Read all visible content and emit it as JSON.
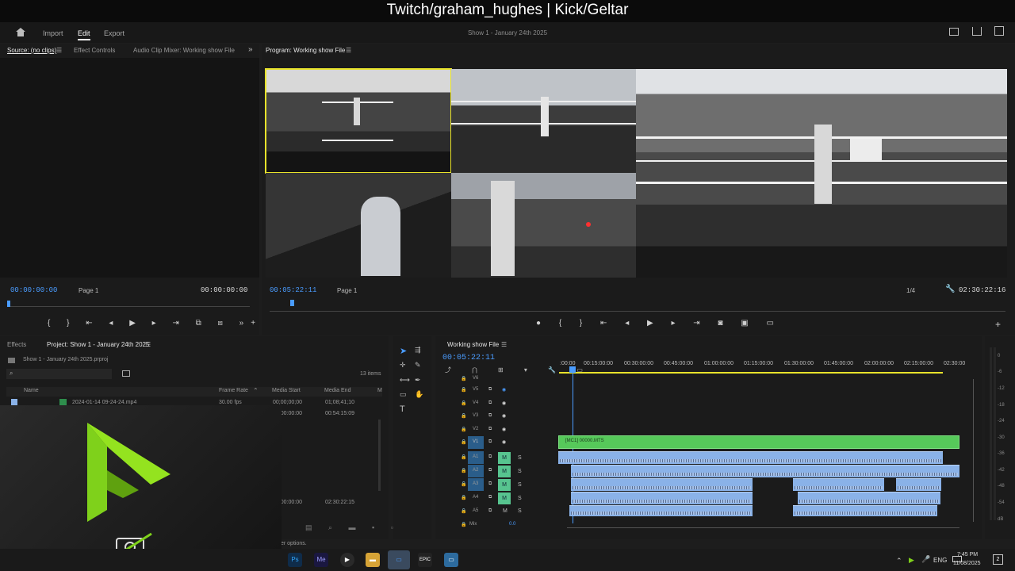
{
  "stream_banner": {
    "text": "Twitch/graham_hughes | Kick/Geltar"
  },
  "workspace_tabs": {
    "import": "Import",
    "edit": "Edit",
    "export": "Export"
  },
  "project_title": "Show 1 - January 24th 2025",
  "source_panel": {
    "tabs": [
      "Source: (no clips)",
      "Effect Controls",
      "Audio Clip Mixer: Working show File"
    ],
    "timecode_in": "00:00:00:00",
    "timecode_out": "00:00:00:00",
    "page": "Page 1"
  },
  "program_panel": {
    "title": "Program: Working show File",
    "timecode": "00:05:22:11",
    "page": "Page 1",
    "zoom": "1/4",
    "duration": "02:30:22:16"
  },
  "project_panel": {
    "tabs": [
      "Effects",
      "Project: Show 1 - January 24th 2025"
    ],
    "file": "Show 1 - January 24th 2025.prproj",
    "item_count": "13 items",
    "columns": [
      "Name",
      "Frame Rate",
      "Media Start",
      "Media End",
      "M"
    ],
    "rows": [
      {
        "name": "2024-01-14 09-24-24.mp4",
        "fps": "30.00 fps",
        "start": "00;00;00;00",
        "end": "01;08;41;10"
      },
      {
        "name": "",
        "fps": "",
        "start": "00:00:00:00",
        "end": "00:54:15:09"
      },
      {
        "name": "",
        "fps": "",
        "start": "00:00:00:00",
        "end": "02:30:22:15"
      }
    ],
    "hint": "er options."
  },
  "timeline": {
    "title": "Working show File",
    "timecode": "00:05:22:11",
    "ruler": [
      ":00:00",
      "00:15:00:00",
      "00:30:00:00",
      "00:45:00:00",
      "01:00:00:00",
      "01:15:00:00",
      "01:30:00:00",
      "01:45:00:00",
      "02:00:00:00",
      "02:15:00:00",
      "02:30:00"
    ],
    "video_tracks": [
      "V6",
      "V5",
      "V4",
      "V3",
      "V2",
      "V1"
    ],
    "audio_tracks": [
      "A1",
      "A2",
      "A3",
      "A4",
      "A5"
    ],
    "mix_label": "Mix",
    "mix_value": "0.0",
    "clip_name": "[MC1] 00000.MTS",
    "meter_labels": [
      "0",
      "-6",
      "-12",
      "-18",
      "-24",
      "-30",
      "-36",
      "-42",
      "-48",
      "-54",
      "dB"
    ]
  },
  "taskbar": {
    "apps": [
      "Ps",
      "Me",
      "EPIC"
    ],
    "lang": "ENG",
    "time": "7:45 PM",
    "date": "11/08/2025",
    "notifications": "2"
  },
  "colors": {
    "accent_blue": "#4a9cff",
    "clip_green": "#56c95a",
    "audio_clip": "#8ab2e8",
    "mute_green": "#57c48f",
    "logo_green": "#7fd11b"
  }
}
